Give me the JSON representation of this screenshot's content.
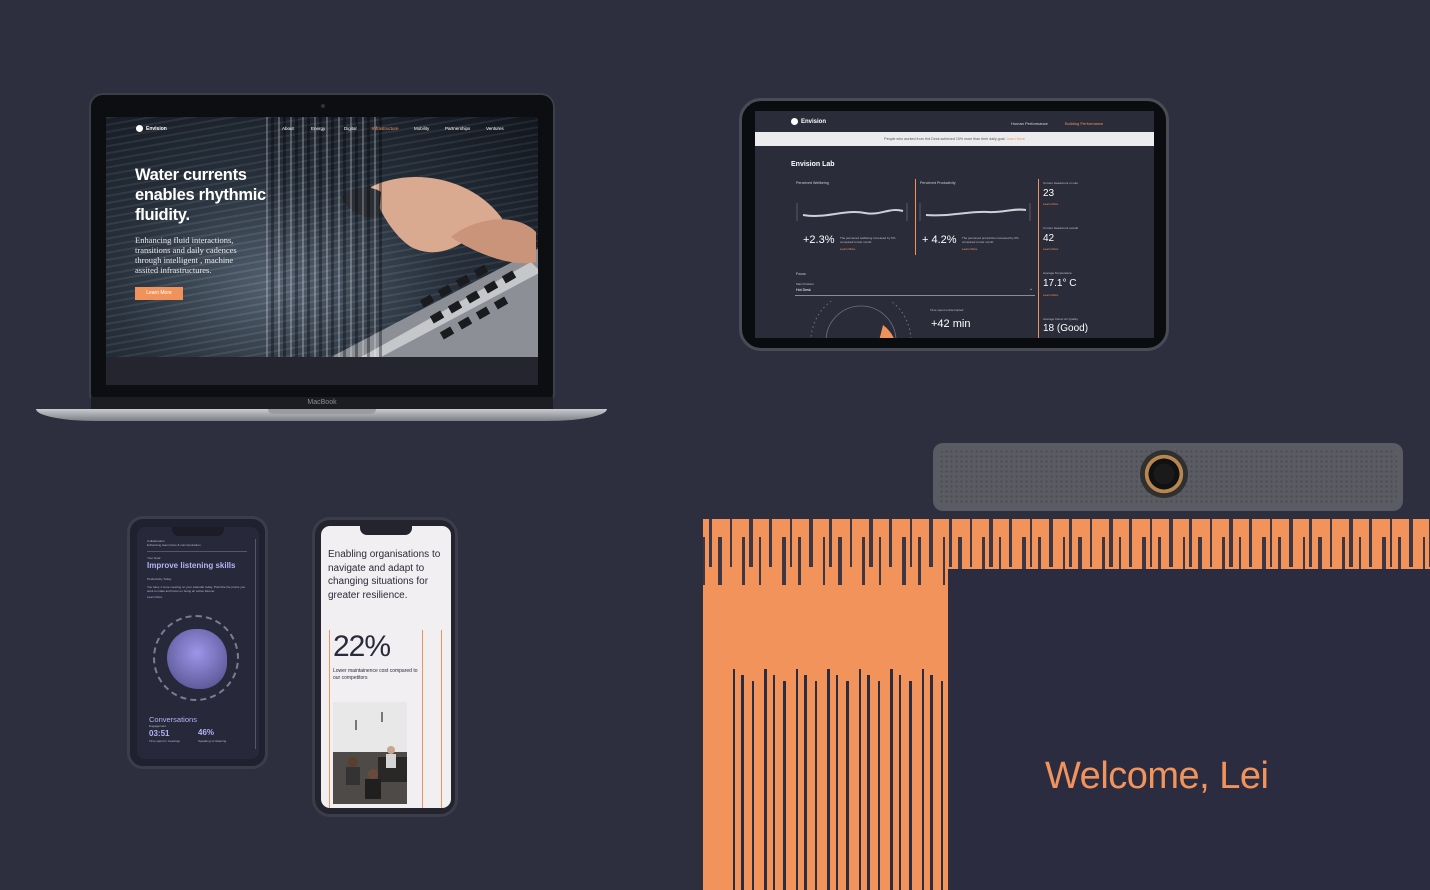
{
  "laptop": {
    "brand_label": "MacBook",
    "nav": {
      "logo": "Envision",
      "items": [
        "About",
        "Energy",
        "Digital",
        "Infrastructure",
        "Mobility",
        "Partnerships",
        "Ventures"
      ],
      "active": "Infrastructure"
    },
    "hero": {
      "title": "Water currents enables rhythmic fluidity.",
      "subtitle": "Enhancing fluid interactions, transitions and daily cadences through intelligent , machine assited infrastructures.",
      "button": "Learn More"
    }
  },
  "tablet": {
    "logo": "Envision",
    "tabs": [
      "Human Performance",
      "Building Performance"
    ],
    "active_tab": "Building Performance",
    "banner_text": "People who worked from Hot Desk achieved 15% more than their daily goal.",
    "banner_link": "Learn More",
    "title": "Envision Lab",
    "wellbeing": {
      "label": "Perceived Wellbeing",
      "value": "+2.3%",
      "note": "The perceived wellbeing increased by 5% compared to last month.",
      "link": "Learn More"
    },
    "productivity": {
      "label": "Perceived Productivity",
      "value": "+ 4.2%",
      "note": "The perceived productive increased by 6% compared to last month.",
      "link": "Learn More"
    },
    "focus": {
      "label": "Focus",
      "sub_label": "Main Position",
      "location": "Hot Desk"
    },
    "time_uninterrupted": {
      "label": "Time spent uninterrupted",
      "value": "+42 min"
    },
    "stats": [
      {
        "label": "Current Headcount on site",
        "value": "23",
        "link": "Learn More"
      },
      {
        "label": "Current Headcount overall",
        "value": "42",
        "link": "Learn More"
      },
      {
        "label": "Average Temperature",
        "value": "17.1° C",
        "link": "Learn More"
      },
      {
        "label": "Average Indoor Air Quality",
        "value": "18 (Good)"
      }
    ]
  },
  "phone_collab": {
    "header": "Collaboration",
    "header_sub": "Enhancing team focus & communication",
    "kicker": "Your Goal",
    "title": "Improve listening skills",
    "sub": "Productivity Today",
    "body": "You have 1 more meeting on your calendar today. Prioritize the points you want to make and focus on being an active listener.",
    "link": "Learn More",
    "conversations": "Conversations",
    "engagement": "Engagement",
    "time": "03:51",
    "time_label": "Time spent in meetings",
    "percent": "46%",
    "percent_label": "Speaking vs listening"
  },
  "phone_resilience": {
    "headline": "Enabling organisations to navigate and adapt to changing situations for greater resilience.",
    "stat": "22%",
    "stat_caption": "Lower maintainence cost compared to our competitors"
  },
  "display": {
    "welcome": "Welcome, Lei"
  },
  "colors": {
    "background": "#2e2f3e",
    "accent": "#f0935a",
    "lavender": "#b6b3f5"
  }
}
